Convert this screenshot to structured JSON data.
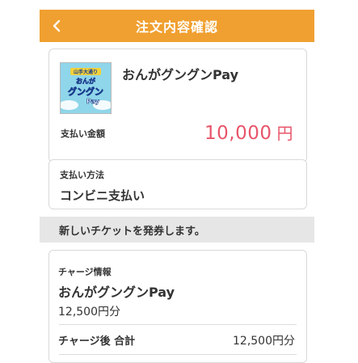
{
  "header": {
    "title": "注文内容確認"
  },
  "product": {
    "name": "おんがグングンPay",
    "image_text": [
      "山手大通り",
      "おんが",
      "グングン",
      "Pay"
    ],
    "amount_label": "支払い金額",
    "amount_value": "10,000",
    "amount_unit": "円"
  },
  "payment": {
    "label": "支払い方法",
    "value": "コンビニ支払い"
  },
  "notice": {
    "text": "新しいチケットを発券します。"
  },
  "charge": {
    "label": "チャージ情報",
    "name": "おんがグングンPay",
    "amount": "12,500円分",
    "total_label": "チャージ後 合計",
    "total_value": "12,500円分"
  },
  "colors": {
    "header_bg": "#f0a030",
    "accent_price": "#e8556a",
    "notice_bg": "#e6e6e6"
  }
}
